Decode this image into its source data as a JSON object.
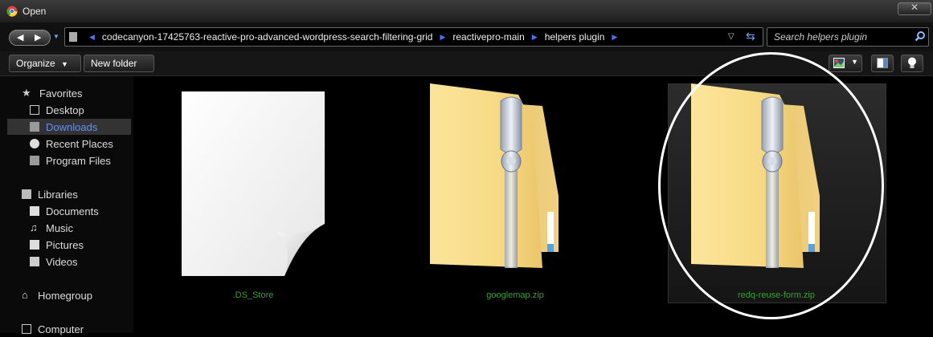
{
  "window": {
    "title": "Open",
    "close_glyph": "✕"
  },
  "address": {
    "crumbs": [
      "codecanyon-17425763-reactive-pro-advanced-wordpress-search-filtering-grid",
      "reactivepro-main",
      "helpers plugin"
    ],
    "search_placeholder": "Search helpers plugin"
  },
  "toolbar": {
    "organize_label": "Organize",
    "new_folder_label": "New folder"
  },
  "sidebar": {
    "favorites_label": "Favorites",
    "favorites": [
      {
        "label": "Desktop",
        "icon": "desktop-icon"
      },
      {
        "label": "Downloads",
        "icon": "downloads-icon",
        "selected": true
      },
      {
        "label": "Recent Places",
        "icon": "recent-places-icon"
      },
      {
        "label": "Program Files",
        "icon": "program-files-icon"
      }
    ],
    "libraries_label": "Libraries",
    "libraries": [
      {
        "label": "Documents",
        "icon": "documents-icon"
      },
      {
        "label": "Music",
        "icon": "music-icon"
      },
      {
        "label": "Pictures",
        "icon": "pictures-icon"
      },
      {
        "label": "Videos",
        "icon": "videos-icon"
      }
    ],
    "homegroup_label": "Homegroup",
    "computer_label": "Computer"
  },
  "files": [
    {
      "name": ".DS_Store",
      "icon": "blank-file-icon"
    },
    {
      "name": "googlemap.zip",
      "icon": "zip-folder-icon"
    },
    {
      "name": "redq-reuse-form.zip",
      "icon": "zip-folder-icon",
      "selected": true,
      "annotated": true
    }
  ],
  "colors": {
    "file_label": "#3c9c3c",
    "selected_nav_text": "#6a8cff",
    "crumb_separator": "#4a72ff",
    "annotation_circle": "#ffffff"
  }
}
